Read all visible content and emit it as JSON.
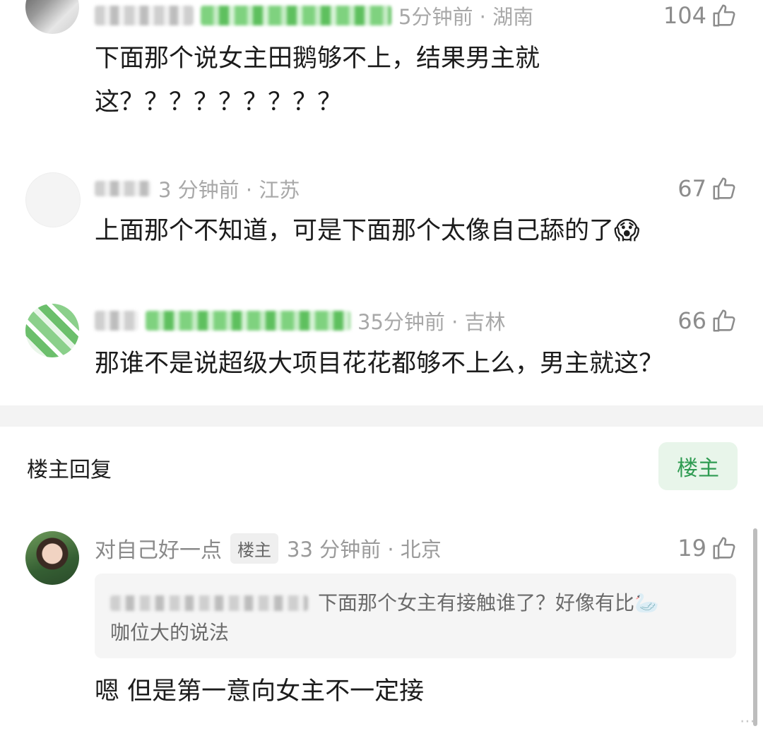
{
  "comments": [
    {
      "time_location": "5分钟前 · 湖南",
      "likes": "104",
      "text": "下面那个说女主田鹅够不上，结果男主就这？？？？？？？？？"
    },
    {
      "time_location": "3 分钟前 · 江苏",
      "likes": "67",
      "text": "上面那个不知道，可是下面那个太像自己舔的了😱"
    },
    {
      "time_location": "35分钟前 · 吉林",
      "likes": "66",
      "text": "那谁不是说超级大项目花花都够不上么，男主就这？"
    }
  ],
  "op_section": {
    "title": "楼主回复",
    "button_label": "楼主",
    "reply": {
      "username": "对自己好一点",
      "badge": "楼主",
      "time_location": "33 分钟前 · 北京",
      "likes": "19",
      "quoted_text_line1": "下面那个女主有接触谁了？好像有比🦢",
      "quoted_text_line2": "咖位大的说法",
      "text": "嗯 但是第一意向女主不一定接"
    }
  },
  "icons": {
    "like": "thumbs-up-icon"
  }
}
